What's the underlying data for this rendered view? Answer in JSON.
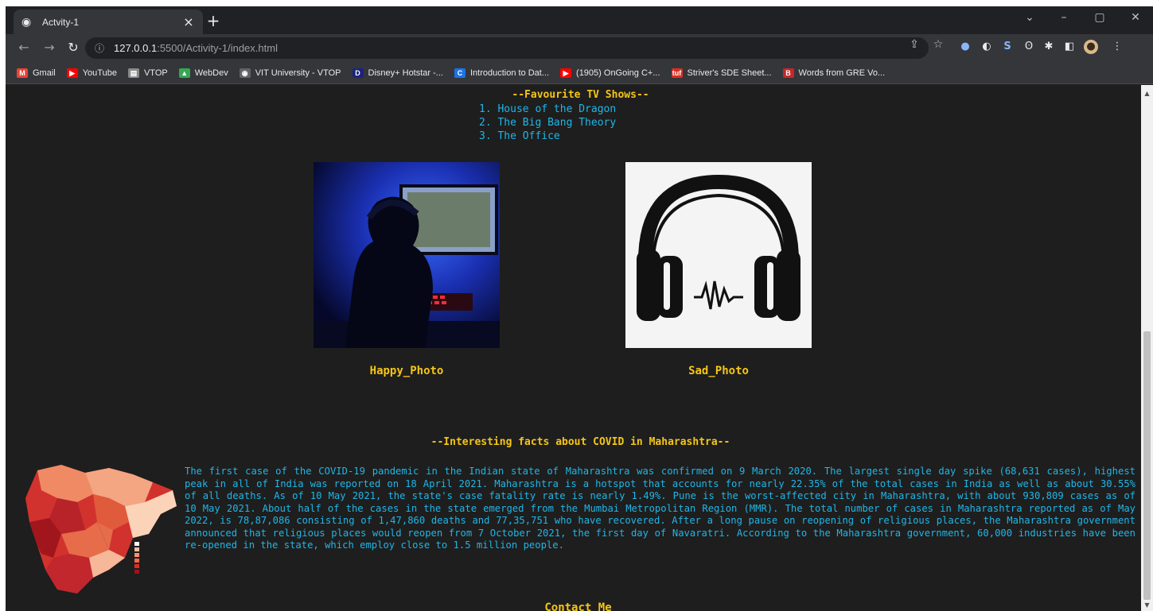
{
  "browser": {
    "tab_title": "Actvity-1",
    "url_host": "127.0.0.1",
    "url_path": ":5500/Activity-1/index.html",
    "bookmarks": [
      {
        "label": "Gmail",
        "color": "#ea4335",
        "glyph": "M"
      },
      {
        "label": "YouTube",
        "color": "#ff0000",
        "glyph": "▶"
      },
      {
        "label": "VTOP",
        "color": "#8a8a8a",
        "glyph": "▤"
      },
      {
        "label": "WebDev",
        "color": "#34a853",
        "glyph": "▲"
      },
      {
        "label": "VIT University - VTOP",
        "color": "#5f6368",
        "glyph": "◉"
      },
      {
        "label": "Disney+ Hotstar -...",
        "color": "#1a237e",
        "glyph": "D"
      },
      {
        "label": "Introduction to Dat...",
        "color": "#1a73e8",
        "glyph": "C"
      },
      {
        "label": "(1905) OnGoing C+...",
        "color": "#ff0000",
        "glyph": "▶"
      },
      {
        "label": "Striver's SDE Sheet...",
        "color": "#d93025",
        "glyph": "tuf"
      },
      {
        "label": "Words from GRE Vo...",
        "color": "#c62828",
        "glyph": "B"
      }
    ]
  },
  "page": {
    "tv_heading": "--Favourite TV Shows--",
    "tv_shows": [
      "1. House of the Dragon",
      "2. The Big Bang Theory",
      "3. The Office"
    ],
    "photo1_caption": "Happy_Photo",
    "photo2_caption": "Sad_Photo",
    "covid_heading": "--Interesting facts about COVID in Maharashtra--",
    "covid_text": "The first case of the COVID-19 pandemic in the Indian state of Maharashtra was confirmed on 9 March 2020. The largest single day spike (68,631 cases), highest peak in all of India was reported on 18 April 2021. Maharashtra is a hotspot that accounts for nearly 22.35% of the total cases in India as well as about 30.55% of all deaths. As of 10 May 2021, the state's case fatality rate is nearly 1.49%. Pune is the worst-affected city in Maharashtra, with about 930,809 cases as of 10 May 2021. About half of the cases in the state emerged from the Mumbai Metropolitan Region (MMR). The total number of cases in Maharashtra reported as of May 2022, is 78,87,086 consisting of 1,47,860 deaths and 77,35,751 who have recovered. After a long pause on reopening of religious places, the Maharashtra government announced that religious places would reopen from 7 October 2021, the first day of Navaratri. According to the Maharashtra government, 60,000 industries have been re-opened in the state, which employ close to 1.5 million people.",
    "contact": "Contact Me"
  },
  "colors": {
    "heading": "#f5c518",
    "text": "#1fb6e8",
    "background": "#1e1e1e"
  }
}
